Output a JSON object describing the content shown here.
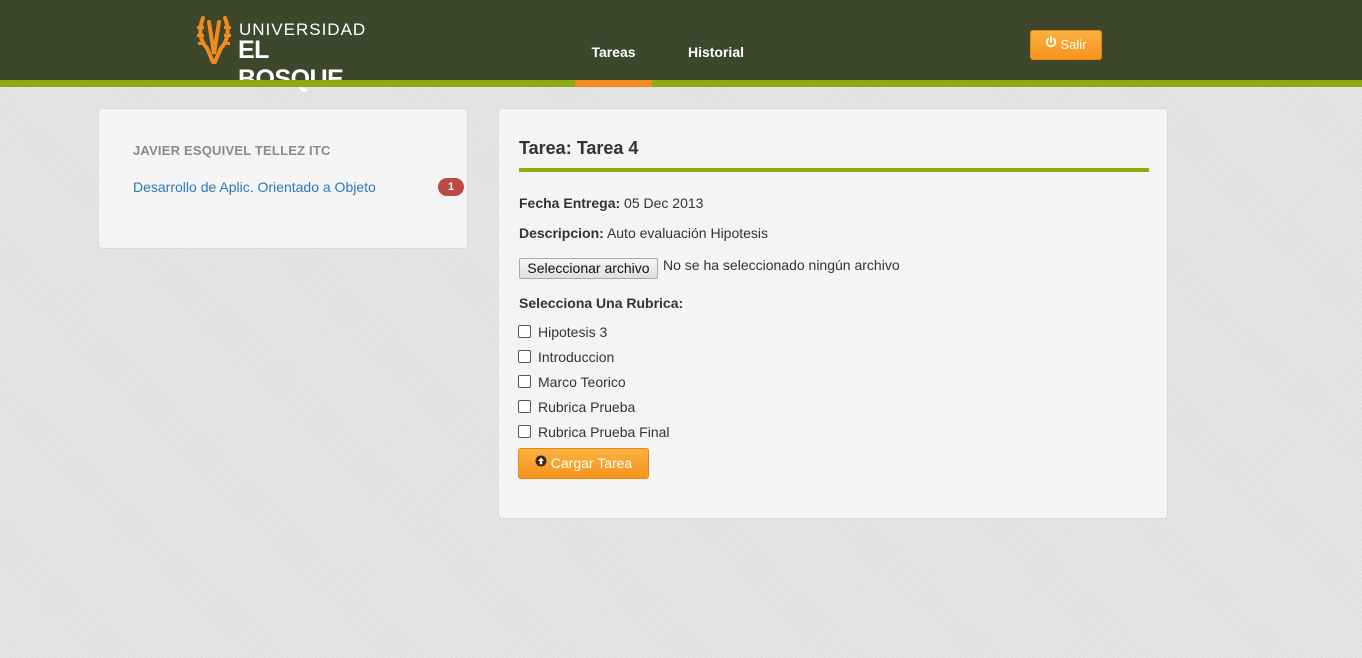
{
  "header": {
    "logo_line1": "UNIVERSIDAD",
    "logo_line2": "EL BOSQUE",
    "nav": [
      {
        "label": "Tareas",
        "active": true
      },
      {
        "label": "Historial",
        "active": false
      }
    ],
    "logout_label": "Salir"
  },
  "colors": {
    "header_bg": "#3e462c",
    "accent_green": "#8eac11",
    "accent_orange": "#f7941d",
    "badge_red": "#b94a48",
    "link_blue": "#2a7ab8"
  },
  "sidebar": {
    "user_name": "JAVIER ESQUIVEL TELLEZ ITC",
    "courses": [
      {
        "name": "Desarrollo de Aplic. Orientado a Objeto",
        "badge": "1"
      }
    ]
  },
  "task": {
    "title": "Tarea: Tarea 4",
    "due_label": "Fecha Entrega:",
    "due_value": "05 Dec 2013",
    "desc_label": "Descripcion:",
    "desc_value": "Auto evaluación Hipotesis",
    "file_button": "Seleccionar archivo",
    "file_status": "No se ha seleccionado ningún archivo",
    "rubric_label": "Selecciona Una Rubrica:",
    "rubrics": [
      {
        "label": "Hipotesis 3",
        "checked": false
      },
      {
        "label": "Introduccion",
        "checked": false
      },
      {
        "label": "Marco Teorico",
        "checked": false
      },
      {
        "label": "Rubrica Prueba",
        "checked": false
      },
      {
        "label": "Rubrica Prueba Final",
        "checked": false
      }
    ],
    "submit_label": "Cargar Tarea"
  },
  "icons": {
    "logo": "university-crest-icon",
    "logout": "power-icon",
    "submit": "upload-circle-icon"
  }
}
